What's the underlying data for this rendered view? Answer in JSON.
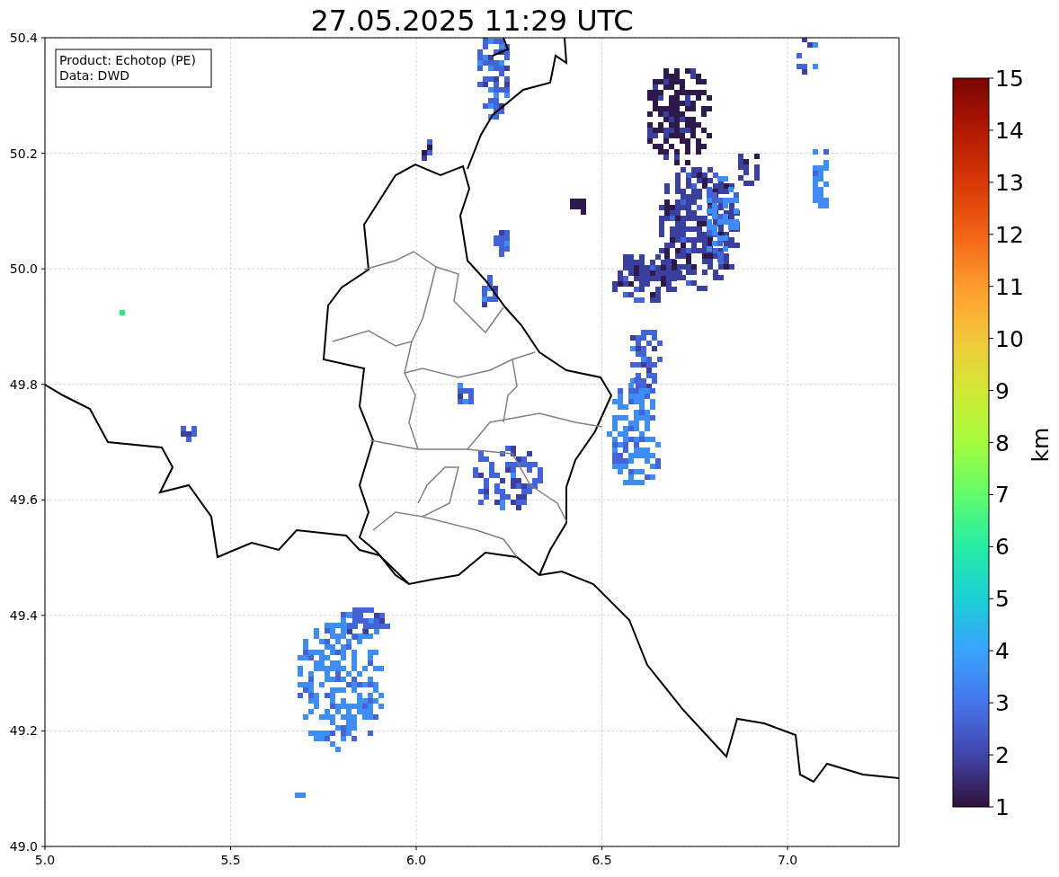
{
  "title": "27.05.2025 11:29 UTC",
  "annotation": [
    "Product: Echotop (PE)",
    "Data: DWD"
  ],
  "x_axis": {
    "ticks": [
      "5.0",
      "5.5",
      "6.0",
      "6.5",
      "7.0"
    ]
  },
  "y_axis": {
    "ticks": [
      "50.4",
      "50.2",
      "50.0",
      "49.8",
      "49.6",
      "49.4",
      "49.2",
      "49.0"
    ]
  },
  "colorbar": {
    "label": "km",
    "ticks": [
      "15",
      "14",
      "13",
      "12",
      "11",
      "10",
      "9",
      "8",
      "7",
      "6",
      "5",
      "4",
      "3",
      "2",
      "1"
    ]
  }
}
